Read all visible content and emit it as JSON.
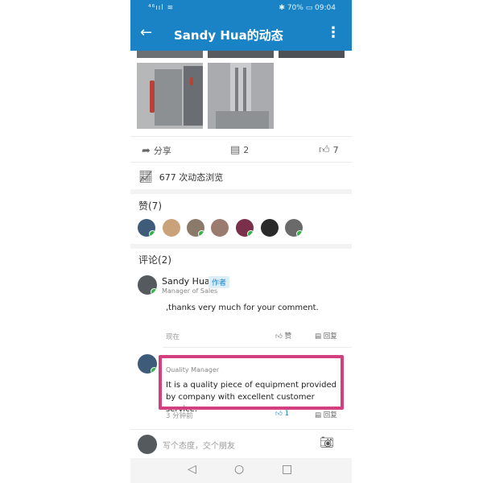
{
  "status": {
    "signal": "⁴⁶ııl ≋",
    "right": "✱ 70% ▭ 09:04"
  },
  "appbar": {
    "title": "Sandy Hua的动态",
    "back": "←",
    "more": "⋮"
  },
  "actions": {
    "share": "分享",
    "comments": "2",
    "likes": "7"
  },
  "views": "677 次动态浏览",
  "likes_title": "赞(7)",
  "comments_title": "评论(2)",
  "comment1": {
    "name": "Sandy Hua",
    "tag": "作者",
    "role": "Manager of Sales",
    "text": ",thanks very much for your comment.",
    "time": "现在",
    "like": "赞",
    "reply": "回复"
  },
  "comment2": {
    "name": "",
    "role": "Quality Manager",
    "text": "It is a quality piece of equipment provided by company with excellent customer service.",
    "time": "3 分钟前",
    "likes": "1",
    "reply": "回复"
  },
  "input_placeholder": "写个态度，交个朋友",
  "colors": {
    "brand": "#1a83c6",
    "highlight": "#d33f7f",
    "online": "#36b24a"
  },
  "icons": {
    "back": "arrow-left-icon",
    "more": "more-vert-icon",
    "share": "share-icon",
    "comment": "comment-icon",
    "like": "thumb-up-icon",
    "views": "trend-chart-icon",
    "camera": "camera-icon"
  }
}
